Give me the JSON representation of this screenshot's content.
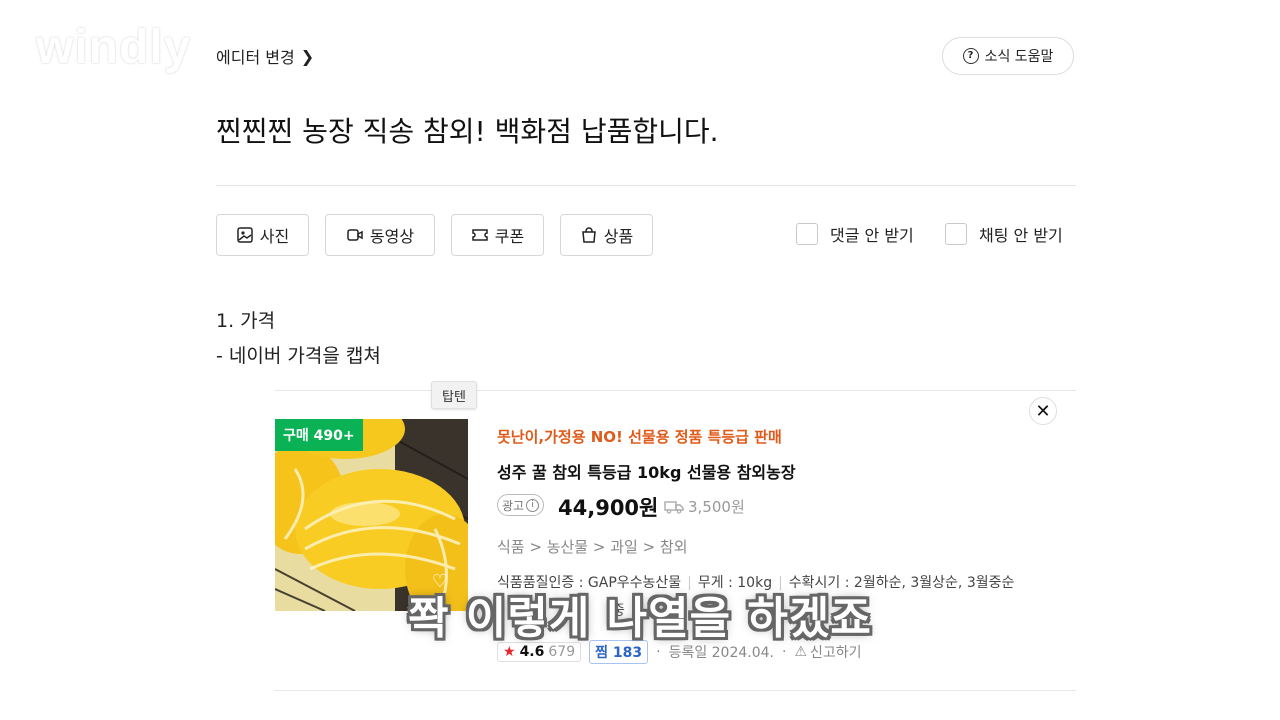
{
  "watermark": "windly",
  "header": {
    "editor_change_label": "에디터 변경",
    "help_label": "소식 도움말"
  },
  "post": {
    "title": "찐찐찐 농장 직송 참외! 백화점 납품합니다.",
    "lines": [
      "1. 가격",
      "- 네이버 가격을 캡쳐"
    ]
  },
  "toolbar": {
    "photo": "사진",
    "video": "동영상",
    "coupon": "쿠폰",
    "product": "상품",
    "no_comments": "댓글 안 받기",
    "no_chat": "채팅 안 받기"
  },
  "card": {
    "tag": "탑텐",
    "badge": "구매 490+",
    "promo": "못난이,가정용 NO! 선물용 정품 특등급 판매",
    "name": "성주 꿀 참외 특등급 10kg 선물용 참외농장",
    "ad_label": "광고",
    "price": "44,900원",
    "shipping": "3,500원",
    "category_path": "식품 > 농산물 > 과일 > 참외",
    "specs": [
      "식품품질인증 : GAP우수농산물",
      "무게 : 10kg",
      "수확시기 : 2월하순, 3월상순, 3월중순"
    ],
    "partial_text": "중",
    "rating": "4.6",
    "review_count": "679",
    "zzim_label": "찜",
    "zzim_count": "183",
    "registered": "등록일 2024.04.",
    "report": "신고하기"
  },
  "subtitle": "쫙 이렇게 나열을 하겠죠",
  "colors": {
    "promo": "#e05a1a",
    "badge_green": "#0bb255",
    "star": "#e8242c",
    "zzim": "#2b65c8"
  }
}
